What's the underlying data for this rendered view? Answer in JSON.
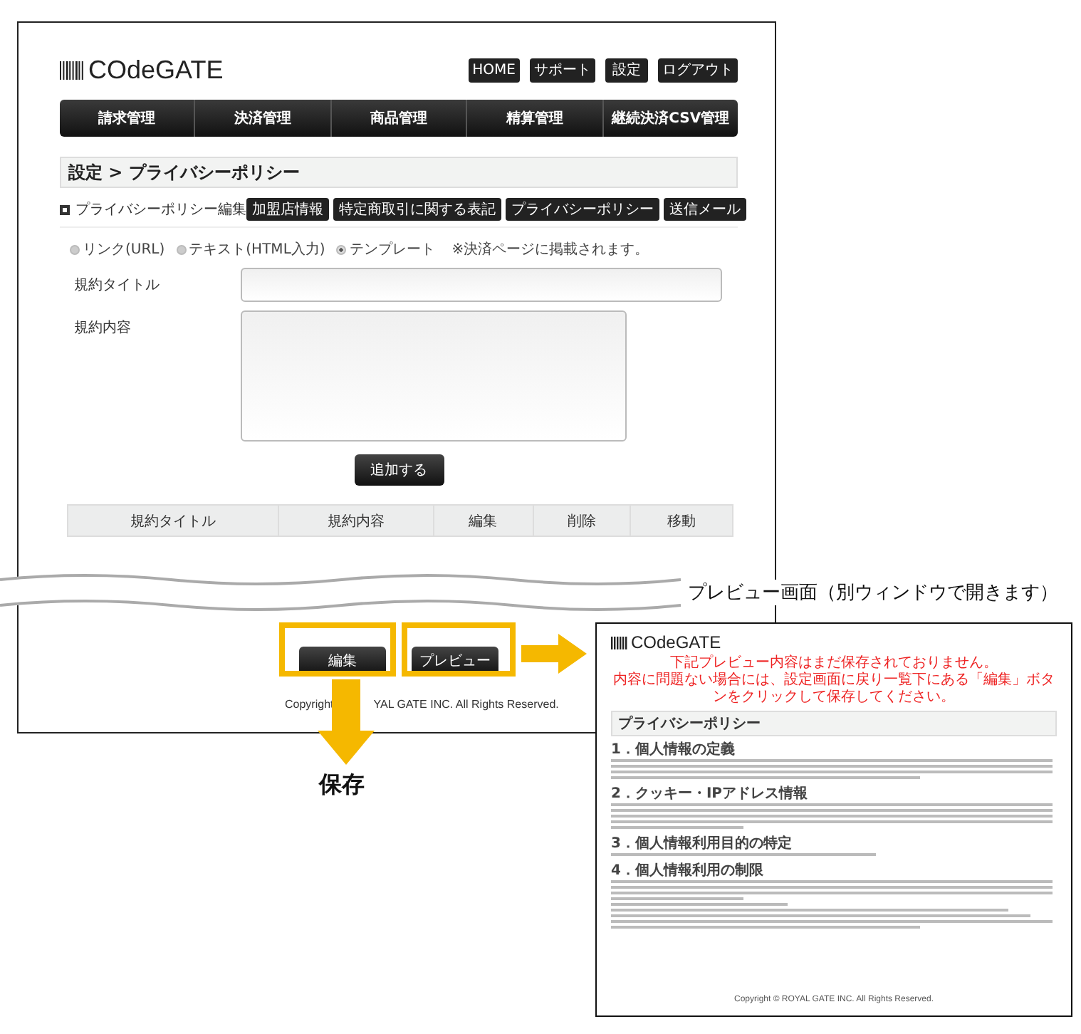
{
  "main_window": {
    "logo": "COdeGATE",
    "header_buttons": [
      "HOME",
      "サポート",
      "設定",
      "ログアウト"
    ],
    "nav": [
      "請求管理",
      "決済管理",
      "商品管理",
      "精算管理",
      "継続決済CSV管理"
    ],
    "breadcrumb": "設定 > プライバシーポリシー",
    "section_title": "プライバシーポリシー編集",
    "section_buttons": [
      "加盟店情報",
      "特定商取引に関する表記",
      "プライバシーポリシー",
      "送信メール"
    ],
    "radios": [
      {
        "label": "リンク(URL)",
        "selected": false
      },
      {
        "label": "テキスト(HTML入力)",
        "selected": false
      },
      {
        "label": "テンプレート",
        "selected": true
      }
    ],
    "radio_note": "※決済ページに掲載されます。",
    "fields": [
      {
        "label": "規約タイトル",
        "kind": "input"
      },
      {
        "label": "規約内容",
        "kind": "textarea"
      }
    ],
    "add_button": "追加する",
    "table_columns": [
      "規約タイトル",
      "規約内容",
      "編集",
      "削除",
      "移動"
    ],
    "footer_buttons": [
      "編集",
      "プレビュー"
    ],
    "copyright_parts": [
      "Copyright",
      "YAL GATE INC. All Rights Reserved."
    ]
  },
  "annotations": {
    "preview_label": "プレビュー画面（別ウィンドウで開きます）",
    "save_label": "保存"
  },
  "preview_window": {
    "logo": "COdeGATE",
    "notices": [
      "下記プレビュー内容はまだ保存されておりません。",
      "内容に問題ない場合には、設定画面に戻り一覧下にある「編集」ボタンをクリックして保存してください。"
    ],
    "title": "プライバシーポリシー",
    "sections": [
      "1．個人情報の定義",
      "2．クッキー・IPアドレス情報",
      "3．個人情報利用目的の特定",
      "4．個人情報利用の制限"
    ],
    "copyright": "Copyright © ROYAL GATE INC. All Rights Reserved."
  }
}
